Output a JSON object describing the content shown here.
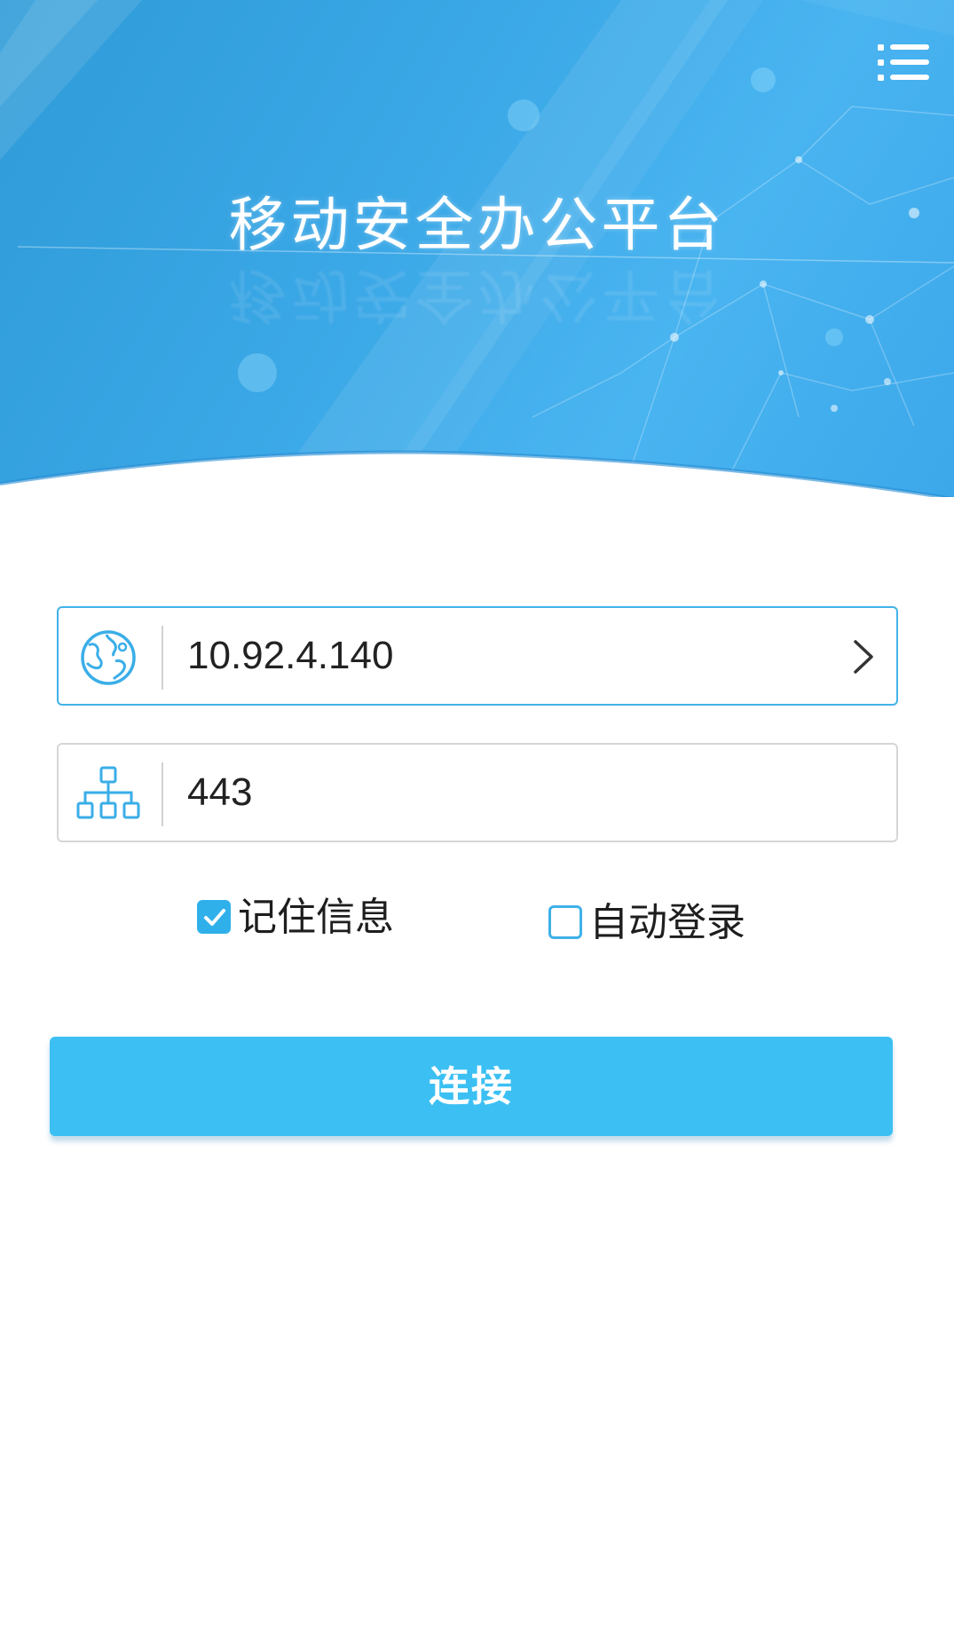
{
  "header": {
    "title": "移动安全办公平台",
    "menu_icon": "menu-list-icon",
    "gradient_colors": [
      "#2f9bd8",
      "#49b4f0"
    ]
  },
  "form": {
    "server": {
      "icon": "globe-icon",
      "value": "10.92.4.140",
      "action_icon": "chevron-right-icon",
      "border_color": "#43b2e8"
    },
    "port": {
      "icon": "network-topology-icon",
      "value": "443",
      "border_color": "#d6d6d6"
    }
  },
  "options": {
    "remember": {
      "label": "记住信息",
      "checked": true
    },
    "autologin": {
      "label": "自动登录",
      "checked": false
    }
  },
  "actions": {
    "connect_label": "连接",
    "connect_color": "#3cc0f3"
  },
  "colors": {
    "accent": "#2fb0ea",
    "background": "#ffffff"
  }
}
